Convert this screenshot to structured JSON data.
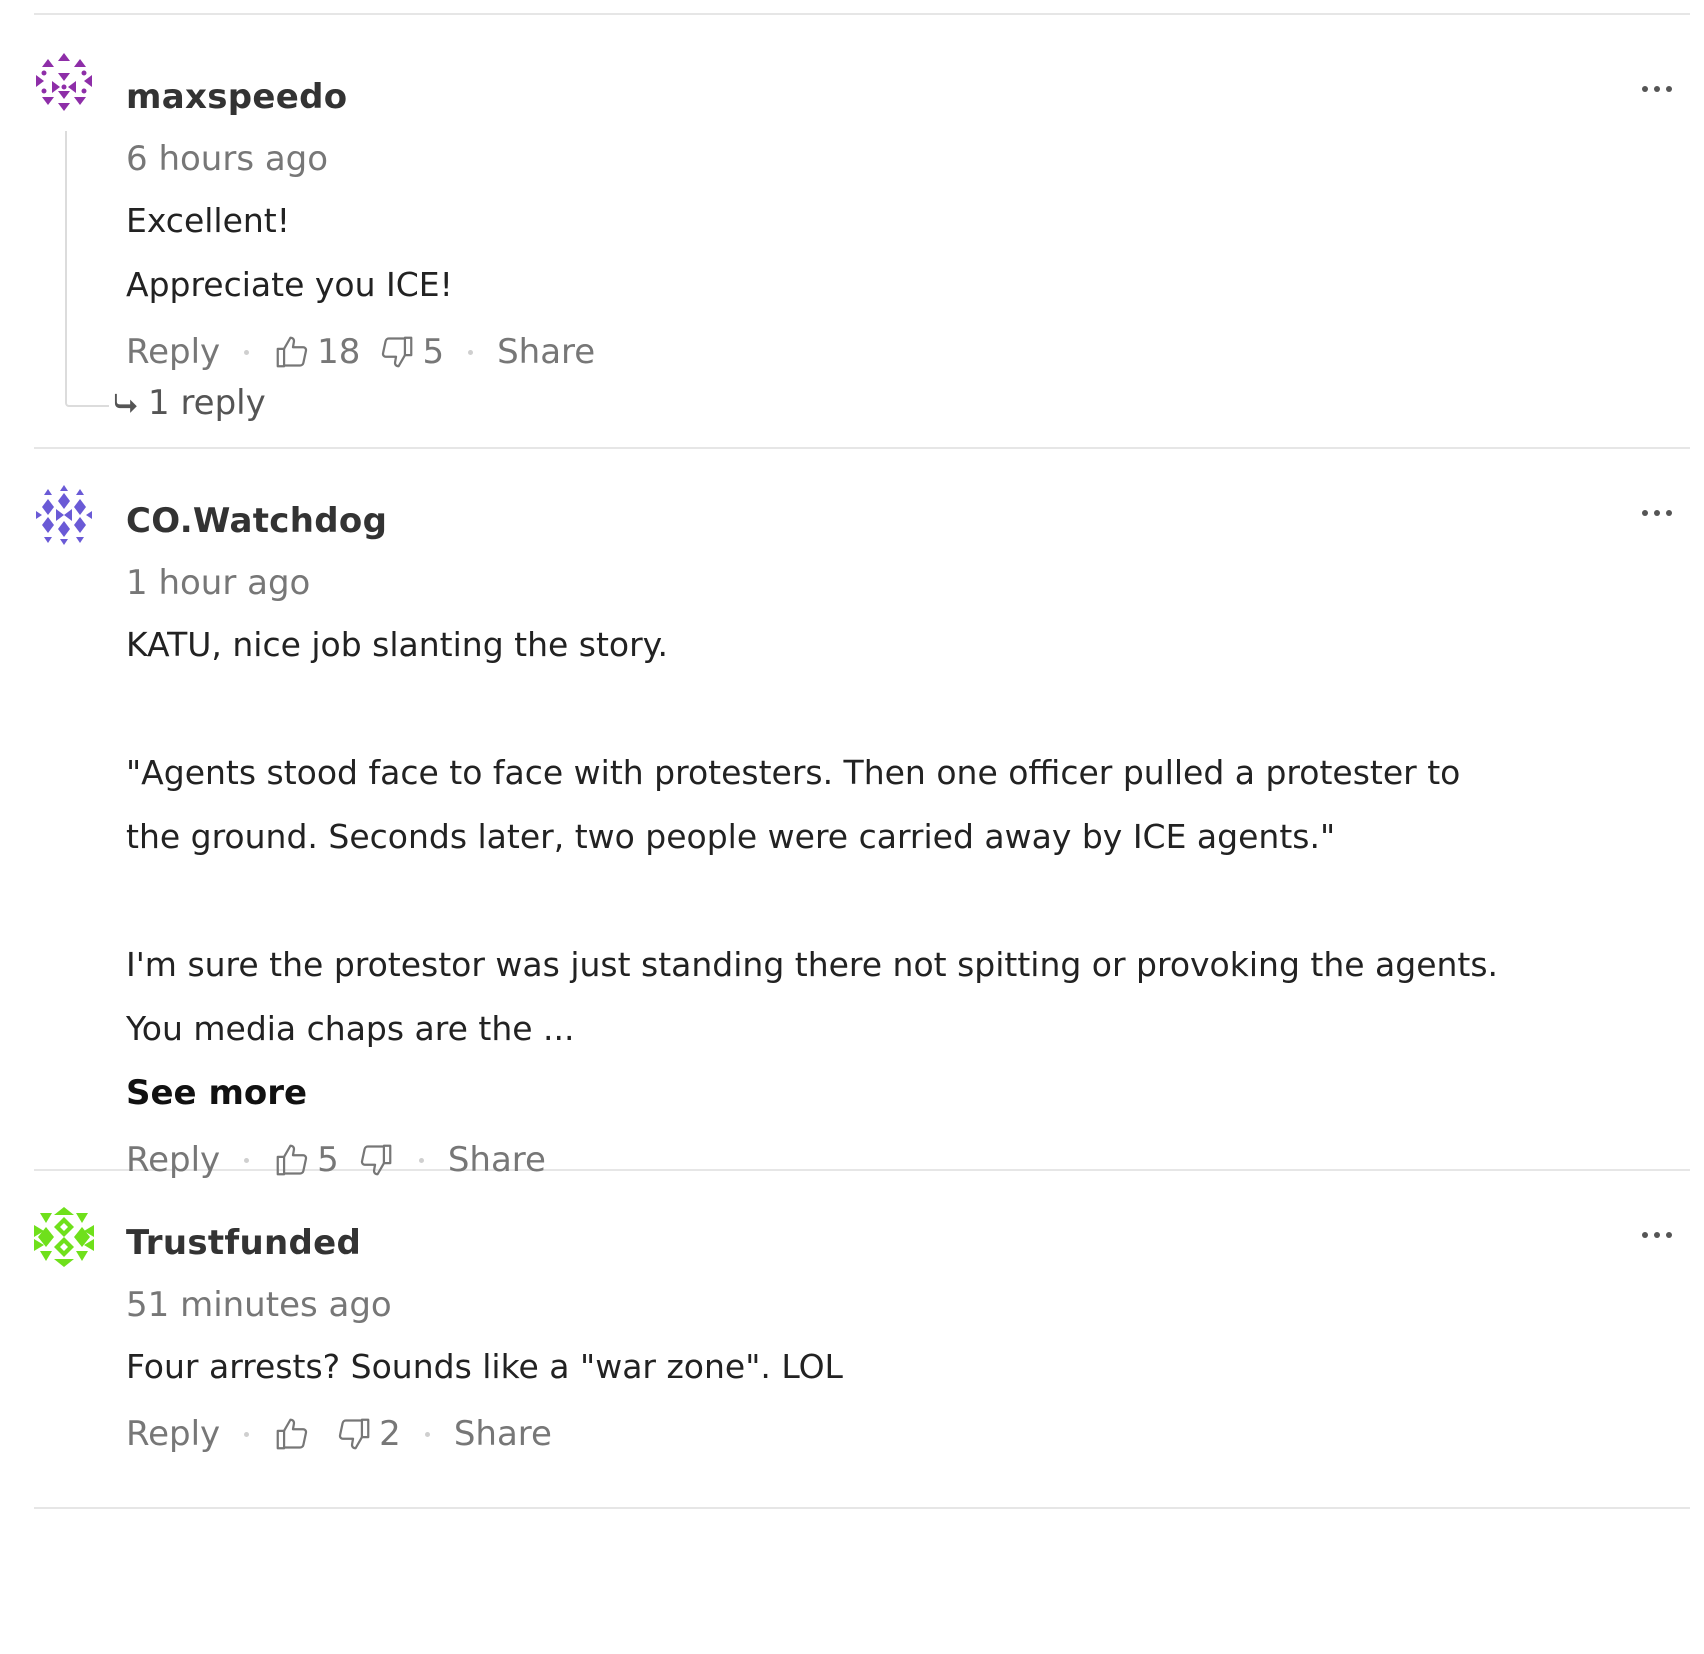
{
  "icons": {
    "thumbs_up": "thumbs-up-icon",
    "thumbs_down": "thumbs-down-icon",
    "more": "more-dots-icon",
    "reply_arrow": "reply-arrow-icon"
  },
  "comments": [
    {
      "author": "maxspeedo",
      "avatar_color": "#8e2ea8",
      "time": "6 hours ago",
      "body": [
        "Excellent!",
        "Appreciate you ICE!"
      ],
      "reply_label": "Reply",
      "upvotes": "18",
      "downvotes": "5",
      "share_label": "Share",
      "replies_label": "1 reply"
    },
    {
      "author": "CO.Watchdog",
      "avatar_color": "#6a5ad6",
      "time": "1 hour ago",
      "body": [
        "KATU, nice job slanting the story.",
        "",
        "\"Agents stood face to face with protesters. Then one officer pulled a protester to",
        "the ground. Seconds later, two people were carried away by ICE agents.\"",
        "",
        "I'm sure the protestor was just standing there not spitting or provoking the agents.",
        "You media chaps are the ..."
      ],
      "see_more_label": "See more",
      "reply_label": "Reply",
      "upvotes": "5",
      "downvotes": "",
      "share_label": "Share"
    },
    {
      "author": "Trustfunded",
      "avatar_color": "#6fe01b",
      "time": "51 minutes ago",
      "body": [
        "Four arrests?  Sounds like a \"war zone\".  LOL"
      ],
      "reply_label": "Reply",
      "upvotes": "",
      "downvotes": "2",
      "share_label": "Share"
    }
  ]
}
